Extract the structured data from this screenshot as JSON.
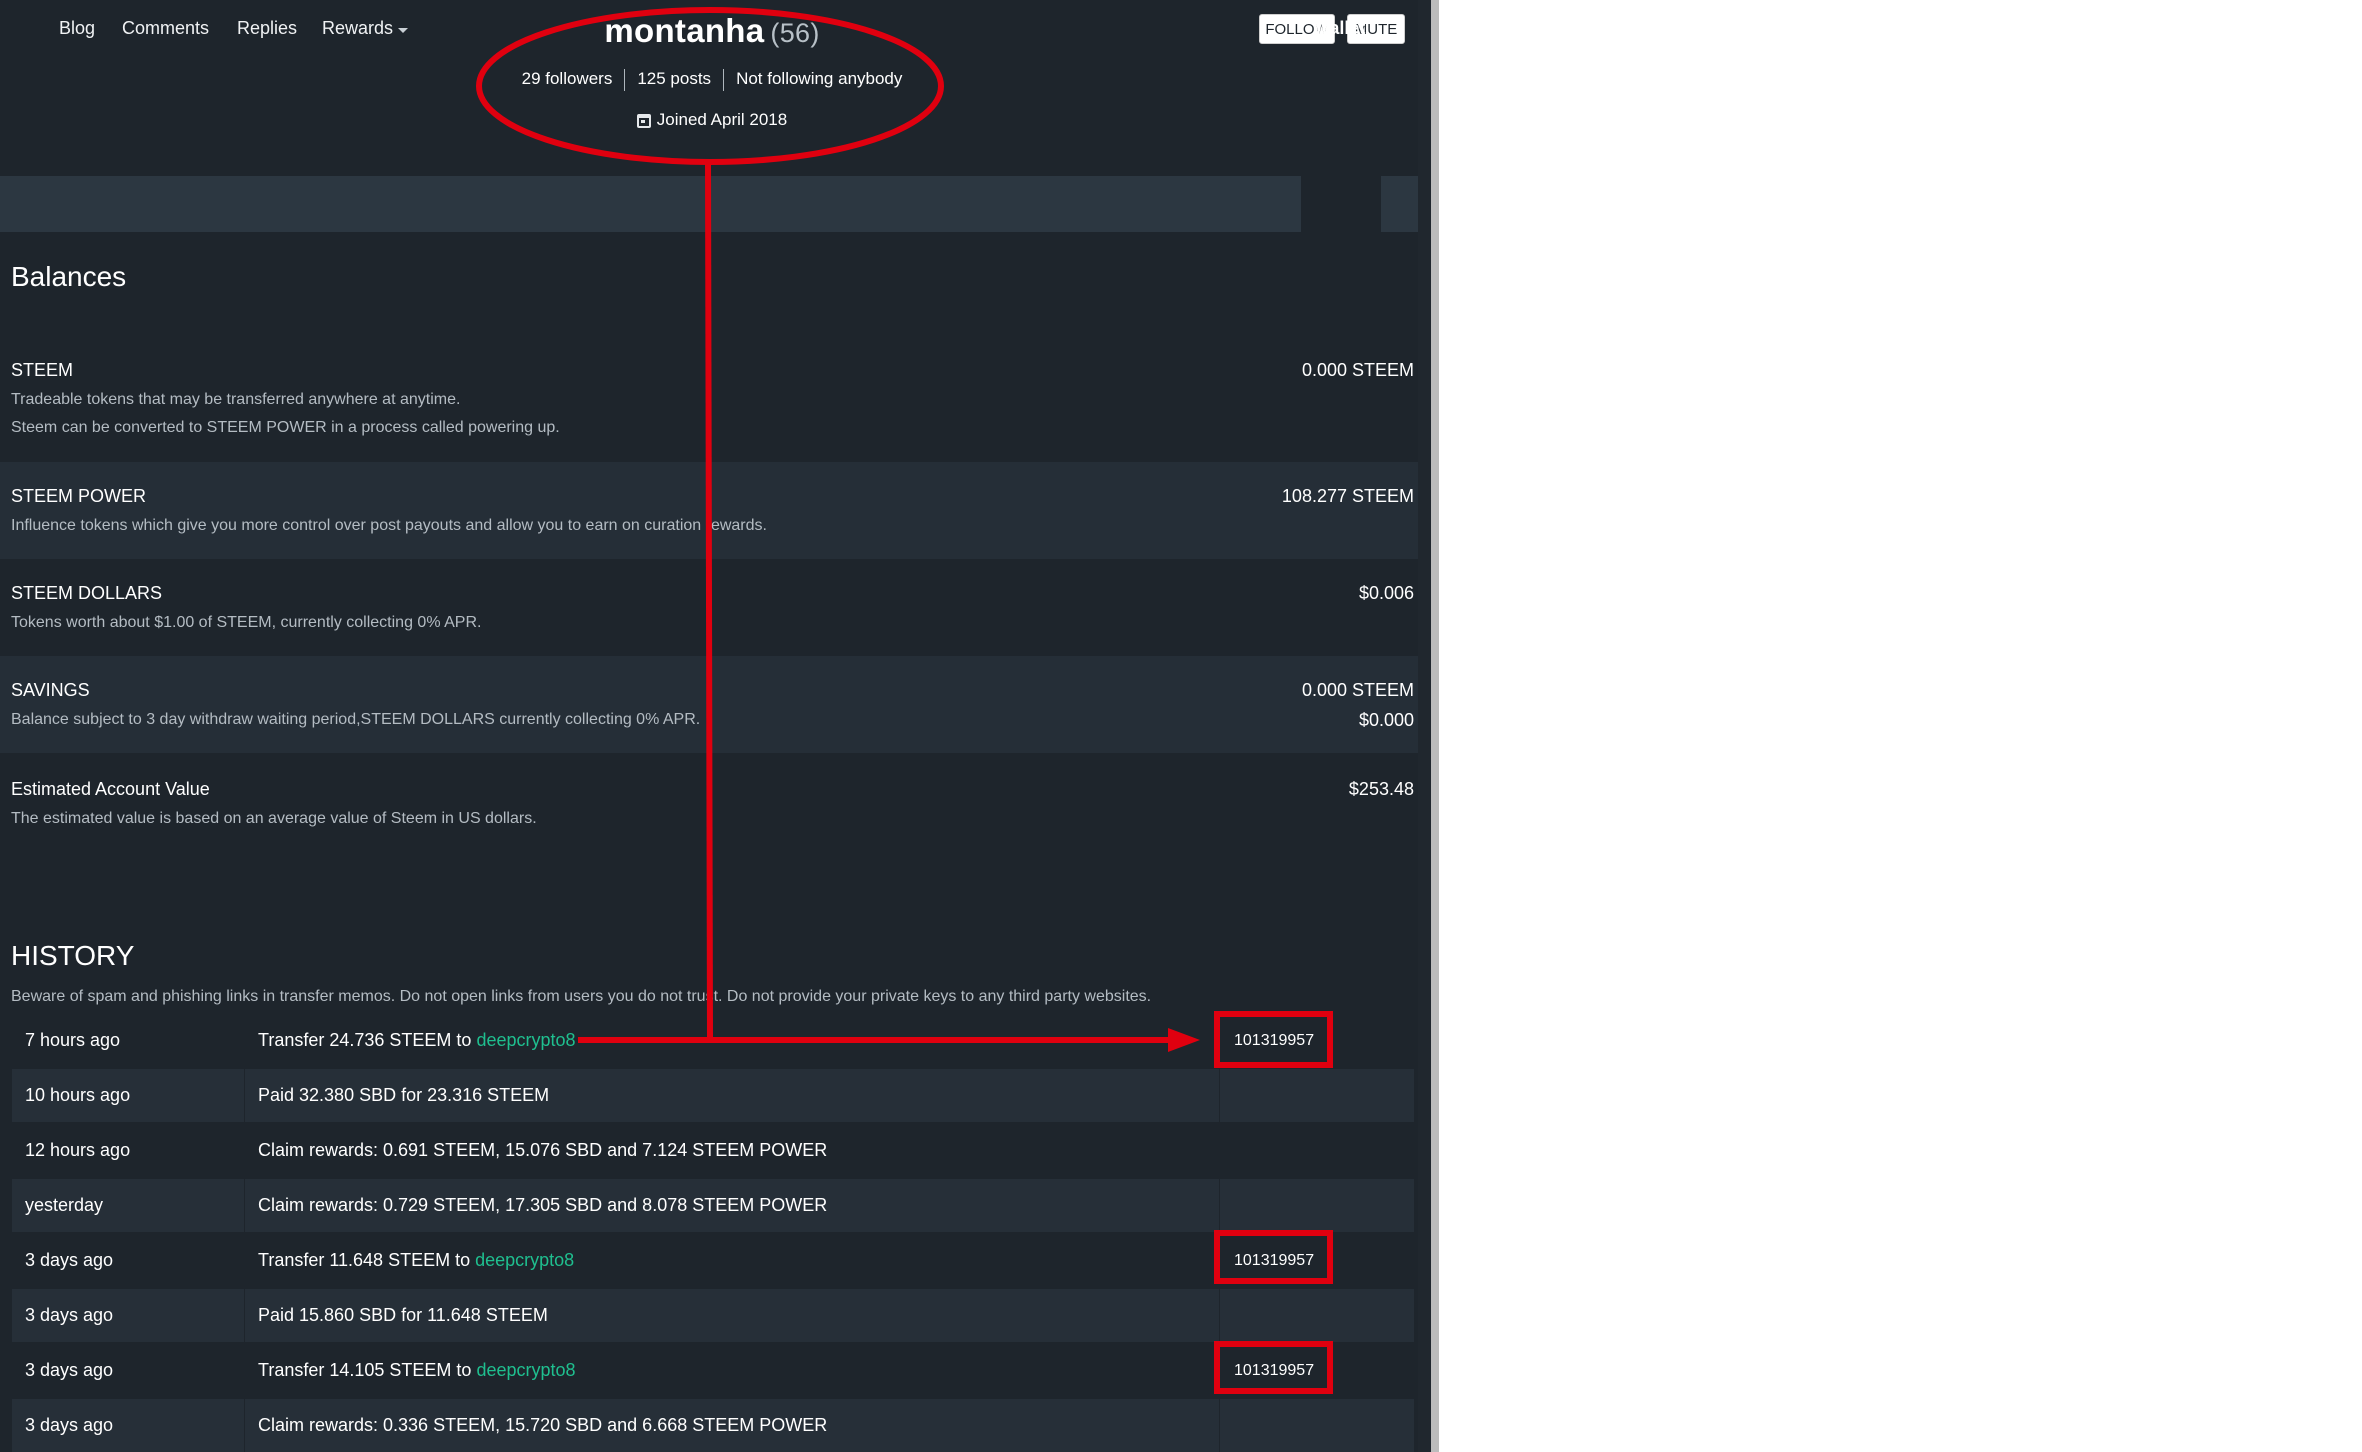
{
  "profile": {
    "username": "montanha",
    "reputation": "(56)",
    "followers": "29 followers",
    "posts": "125 posts",
    "following": "Not following anybody",
    "joined": "Joined April 2018",
    "follow_label": "FOLLOW",
    "mute_label": "MUTE"
  },
  "nav": {
    "blog": "Blog",
    "comments": "Comments",
    "replies": "Replies",
    "rewards": "Rewards",
    "wallet": "Wallet"
  },
  "balances": {
    "title": "Balances",
    "steem": {
      "label": "STEEM",
      "desc1": "Tradeable tokens that may be transferred anywhere at anytime.",
      "desc2": "Steem can be converted to STEEM POWER in a process called powering up.",
      "value": "0.000 STEEM"
    },
    "steem_power": {
      "label": "STEEM POWER",
      "desc": "Influence tokens which give you more control over post payouts and allow you to earn on curation rewards.",
      "value": "108.277 STEEM"
    },
    "steem_dollars": {
      "label": "STEEM DOLLARS",
      "desc": "Tokens worth about $1.00 of STEEM, currently collecting 0% APR.",
      "value": "$0.006"
    },
    "savings": {
      "label": "SAVINGS",
      "desc": "Balance subject to 3 day withdraw waiting period,STEEM DOLLARS currently collecting 0% APR.",
      "value1": "0.000 STEEM",
      "value2": "$0.000"
    },
    "estimated": {
      "label": "Estimated Account Value",
      "desc": "The estimated value is based on an average value of Steem in US dollars.",
      "value": "$253.48"
    }
  },
  "history": {
    "title": "HISTORY",
    "warning": "Beware of spam and phishing links in transfer memos. Do not open links from users you do not trust. Do not provide your private keys to any third party websites.",
    "rows": [
      {
        "time": "7 hours ago",
        "op": "Transfer 24.736 STEEM to ",
        "account": "deepcrypto8",
        "memo": "101319957"
      },
      {
        "time": "10 hours ago",
        "op": "Paid 32.380 SBD for 23.316 STEEM",
        "account": "",
        "memo": ""
      },
      {
        "time": "12 hours ago",
        "op": "Claim rewards: 0.691 STEEM, 15.076 SBD and 7.124 STEEM POWER",
        "account": "",
        "memo": ""
      },
      {
        "time": "yesterday",
        "op": "Claim rewards: 0.729 STEEM, 17.305 SBD and 8.078 STEEM POWER",
        "account": "",
        "memo": ""
      },
      {
        "time": "3 days ago",
        "op": "Transfer 11.648 STEEM to ",
        "account": "deepcrypto8",
        "memo": "101319957"
      },
      {
        "time": "3 days ago",
        "op": "Paid 15.860 SBD for 11.648 STEEM",
        "account": "",
        "memo": ""
      },
      {
        "time": "3 days ago",
        "op": "Transfer 14.105 STEEM to ",
        "account": "deepcrypto8",
        "memo": "101319957"
      },
      {
        "time": "3 days ago",
        "op": "Claim rewards: 0.336 STEEM, 15.720 SBD and 6.668 STEEM POWER",
        "account": "",
        "memo": ""
      }
    ]
  },
  "colors": {
    "background": "#1e252c",
    "alt_row": "#262f38",
    "nav_bar": "#2c3741",
    "account_link": "#1fbf8f",
    "annotation": "#e0000f"
  }
}
